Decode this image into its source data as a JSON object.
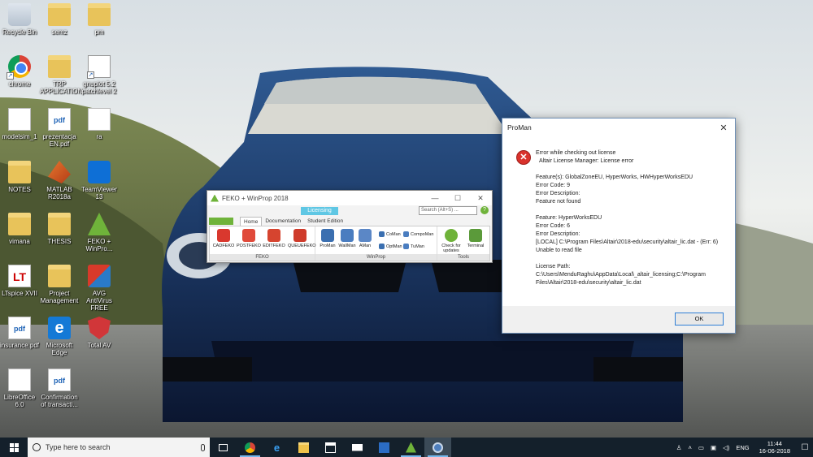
{
  "desktop": {
    "icons": [
      {
        "label": "Recycle Bin"
      },
      {
        "label": "semz"
      },
      {
        "label": "pm"
      },
      {
        "label": "chrome"
      },
      {
        "label": "TRP APPLICATION"
      },
      {
        "label": "gnuplot 5.2 patchlevel 2"
      },
      {
        "label": "modelsim_1"
      },
      {
        "label": "prezentacja EN.pdf"
      },
      {
        "label": "ra"
      },
      {
        "label": "NOTES"
      },
      {
        "label": "MATLAB R2018a"
      },
      {
        "label": "TeamViewer 13"
      },
      {
        "label": "vimana"
      },
      {
        "label": "THESIS"
      },
      {
        "label": "FEKO + WinPro..."
      },
      {
        "label": "LTspice XVII"
      },
      {
        "label": "Project Management"
      },
      {
        "label": "AVG AntiVirus FREE"
      },
      {
        "label": "insurance.pdf"
      },
      {
        "label": "Microsoft Edge"
      },
      {
        "label": "Total AV"
      },
      {
        "label": "LibreOffice 6.0"
      },
      {
        "label": "Confirmation of transacti..."
      }
    ],
    "pdf_badge": "pdf"
  },
  "feko": {
    "title": "FEKO + WinProp 2018",
    "context_tab": "Licensing",
    "search_placeholder": "Search (Alt+S) ...",
    "help": "?",
    "tabs": [
      "Home",
      "Documentation",
      "Student Edition"
    ],
    "groups": {
      "feko": {
        "name": "FEKO",
        "buttons": [
          "CADFEKO",
          "POSTFEKO",
          "EDITFEKO",
          "QUEUEFEKO"
        ]
      },
      "winprop": {
        "name": "WinProp",
        "buttons": [
          "ProMan",
          "WallMan",
          "AMan"
        ],
        "small": [
          "CoMan",
          "CompoMan",
          "OptMan",
          "TuMan"
        ]
      },
      "tools": {
        "name": "Tools",
        "buttons": [
          "Check for updates",
          "Terminal"
        ]
      }
    }
  },
  "dialog": {
    "title": "ProMan",
    "close": "✕",
    "icon_glyph": "✕",
    "lines": {
      "l1": "Error while checking out license",
      "l2": "Altair License Manager: License error",
      "l3": "Feature(s): GlobalZoneEU, HyperWorks, HWHyperWorksEDU",
      "l4": "Error Code: 9",
      "l5": "Error Description:",
      "l6": "Feature not found",
      "l7": "Feature: HyperWorksEDU",
      "l8": "Error Code: 6",
      "l9": "Error Description:",
      "l10": "[LOCAL] C:\\Program Files\\Altair\\2018-edu\\security\\altair_lic.dat - (Err: 6) Unable to read file",
      "l11": "License Path:",
      "l12": "C:\\Users\\MenduRaghu\\AppData\\Local\\_altair_licensing;C:\\Program Files\\Altair\\2018-edu\\security\\altair_lic.dat"
    },
    "ok": "OK"
  },
  "taskbar": {
    "search_placeholder": "Type here to search",
    "apps": [
      "task-view",
      "chrome",
      "edge",
      "file-explorer",
      "store",
      "mail",
      "office",
      "feko",
      "proman"
    ],
    "tray": {
      "lang": "ENG",
      "time": "11:44",
      "date": "16-06-2018"
    }
  },
  "colors": {
    "accent": "#2f7fd6",
    "error": "#d9322c",
    "feko_green": "#6fb33a",
    "licensing": "#5fc7e4",
    "taskbar": "#14202b"
  }
}
